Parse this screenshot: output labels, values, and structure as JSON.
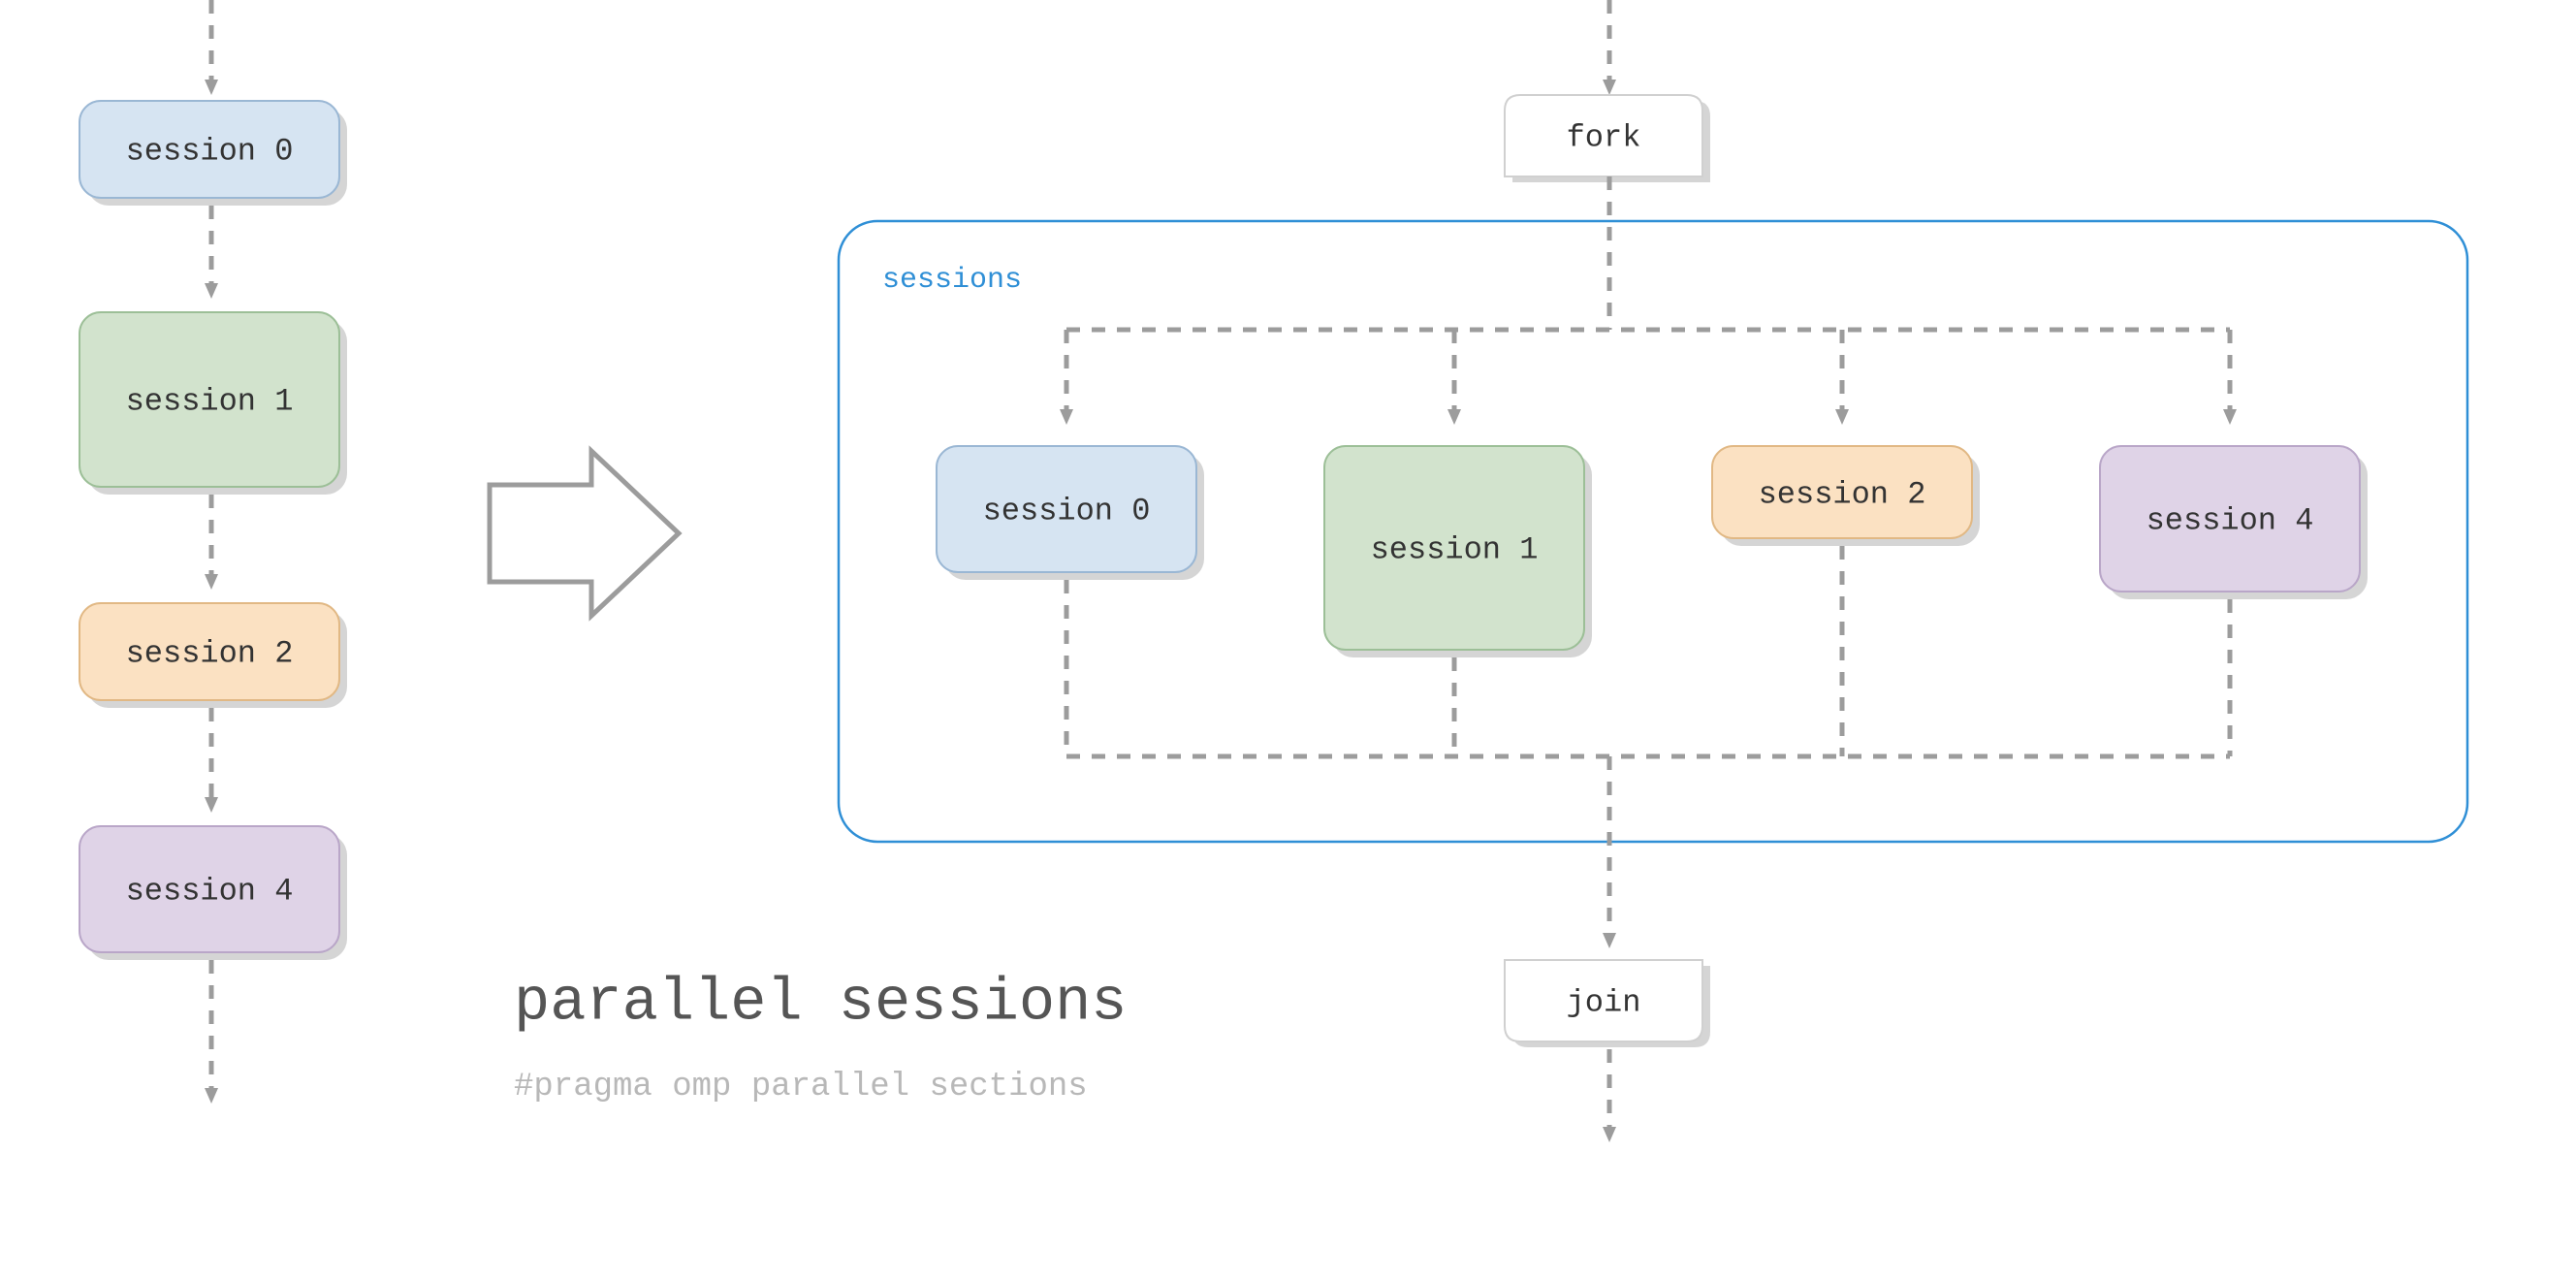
{
  "title": "parallel sessions",
  "subtitle": "#pragma omp parallel sections",
  "container_label": "sessions",
  "fork_label": "fork",
  "join_label": "join",
  "sessions": [
    {
      "label": "session 0",
      "fill": "#d6e4f2",
      "border": "#9ab7d4"
    },
    {
      "label": "session 1",
      "fill": "#d2e3cd",
      "border": "#9cbf97"
    },
    {
      "label": "session 2",
      "fill": "#fbe1c2",
      "border": "#e1b884"
    },
    {
      "label": "session 4",
      "fill": "#dfd3e7",
      "border": "#b9a6c8"
    }
  ],
  "colors": {
    "shadow": "#d5d5d5",
    "container_border": "#2f8fd6",
    "fork_fill": "#ffffff",
    "fork_border": "#d0d0d0"
  }
}
